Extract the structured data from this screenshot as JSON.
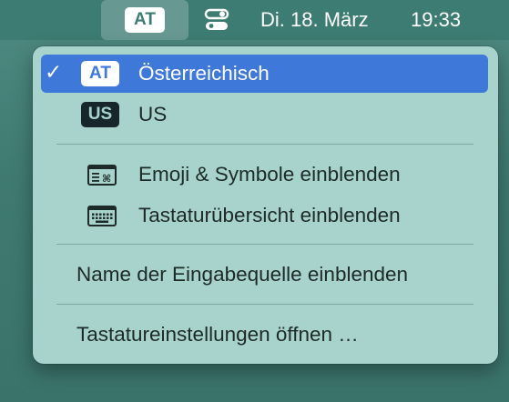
{
  "menubar": {
    "input_source_badge": "AT",
    "control_center_icon": "control-center-icon",
    "date": "Di. 18. März",
    "time": "19:33"
  },
  "menu": {
    "items": [
      {
        "badge": "AT",
        "label": "Österreichisch",
        "checked": true,
        "selected": true
      },
      {
        "badge": "US",
        "label": "US",
        "checked": false,
        "selected": false
      }
    ],
    "emoji_label": "Emoji & Symbole einblenden",
    "emoji_icon": "emoji-viewer-icon",
    "keyboard_viewer_label": "Tastaturübersicht einblenden",
    "keyboard_viewer_icon": "keyboard-icon",
    "show_input_name_label": "Name der Eingabequelle einblenden",
    "keyboard_settings_label": "Tastatureinstellungen öffnen …",
    "checkmark": "✓"
  },
  "colors": {
    "desktop": "#3d7c72",
    "menu_bg": "#a7d3cc",
    "selection": "#3e78d9"
  }
}
